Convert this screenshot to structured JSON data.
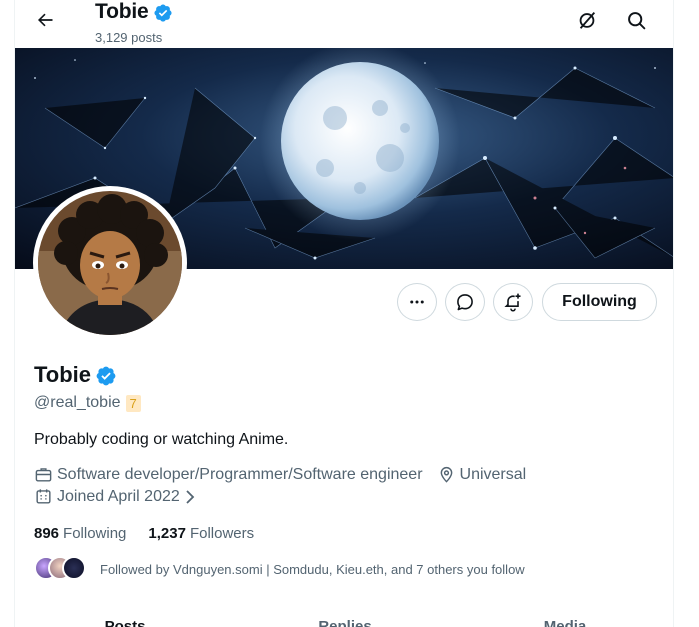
{
  "header": {
    "title": "Tobie",
    "posts": "3,129 posts"
  },
  "profile": {
    "name": "Tobie",
    "handle": "@real_tobie",
    "handle_badge": "7",
    "bio": "Probably coding or watching Anime.",
    "occupation": "Software developer/Programmer/Software engineer",
    "location": "Universal",
    "joined": "Joined April 2022",
    "following_count": "896",
    "following_label": "Following",
    "followers_count": "1,237",
    "followers_label": "Followers",
    "followed_by": "Followed by Vdnguyen.somi | Somdudu, Kieu.eth, and 7 others you follow"
  },
  "actions": {
    "following_button": "Following"
  },
  "tabs": [
    "Posts",
    "Replies",
    "Media"
  ],
  "colors": {
    "verified": "#1d9bf0",
    "text_primary": "#0f1419",
    "text_secondary": "#536471",
    "border": "#cfd9de"
  },
  "icons": {
    "back": "arrow-left-icon",
    "grok": "slash-circle-icon",
    "search": "search-icon",
    "more": "more-horizontal-icon",
    "message": "message-bubble-icon",
    "notify": "bell-plus-icon",
    "verified": "verified-badge-icon",
    "briefcase": "briefcase-icon",
    "location": "location-pin-icon",
    "calendar": "calendar-icon",
    "chevron": "chevron-right-icon"
  }
}
